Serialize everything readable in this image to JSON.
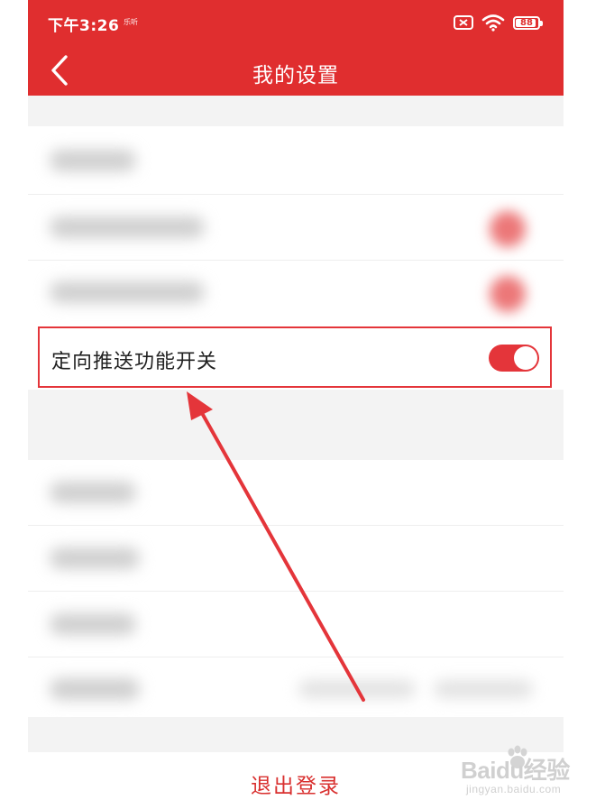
{
  "status_bar": {
    "time": "下午3:26",
    "small_label": "乐听",
    "battery_level": "88"
  },
  "header": {
    "title": "我的设置"
  },
  "settings": {
    "push_toggle": {
      "label": "定向推送功能开关",
      "enabled": true
    }
  },
  "logout": {
    "label": "退出登录"
  },
  "watermark": {
    "brand": "Baidu经验",
    "site": "jingyan.baidu.com"
  },
  "colors": {
    "brand_red": "#e02e2f",
    "annotation_red": "#e4353a",
    "background": "#f3f3f3"
  }
}
